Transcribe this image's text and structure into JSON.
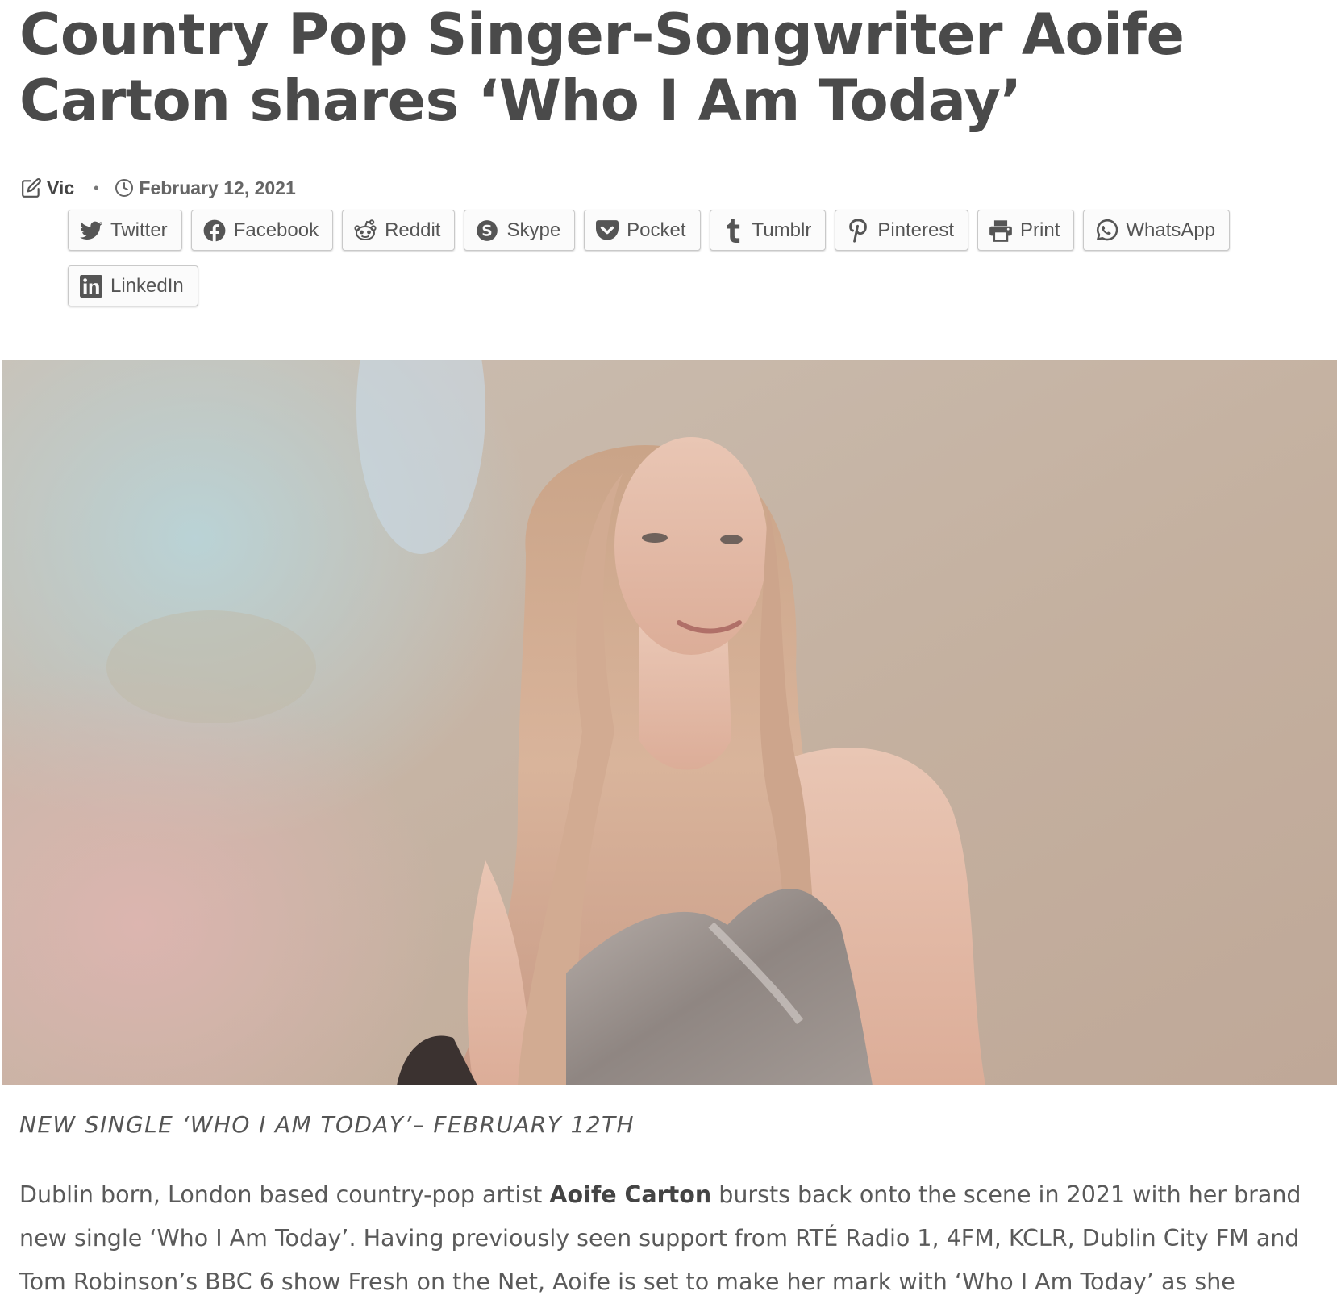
{
  "article": {
    "title": "Country Pop Singer-Songwriter Aoife Carton shares ‘Who I Am Today’",
    "author": "Vic",
    "date": "February 12, 2021",
    "caption": "NEW SINGLE ‘WHO I AM TODAY’– FEBRUARY 12TH",
    "body": {
      "intro": "Dublin born, London based country-pop artist ",
      "artist": "Aoife Carton",
      "rest": " bursts back onto the scene in 2021 with her brand new single ‘Who I Am Today’. Having previously seen support from RTÉ Radio 1, 4FM, KCLR, Dublin City FM and Tom Robinson’s BBC 6 show Fresh on the Net, Aoife is set to make her mark with ‘Who I Am Today’ as she expertly"
    }
  },
  "share": {
    "buttons": [
      {
        "label": "Twitter",
        "icon": "twitter-icon"
      },
      {
        "label": "Facebook",
        "icon": "facebook-icon"
      },
      {
        "label": "Reddit",
        "icon": "reddit-icon"
      },
      {
        "label": "Skype",
        "icon": "skype-icon"
      },
      {
        "label": "Pocket",
        "icon": "pocket-icon"
      },
      {
        "label": "Tumblr",
        "icon": "tumblr-icon"
      },
      {
        "label": "Pinterest",
        "icon": "pinterest-icon"
      },
      {
        "label": "Print",
        "icon": "print-icon"
      },
      {
        "label": "WhatsApp",
        "icon": "whatsapp-icon"
      },
      {
        "label": "LinkedIn",
        "icon": "linkedin-icon"
      }
    ]
  },
  "colors": {
    "title": "#4a4a4a",
    "text": "#5a5a5a",
    "button_border": "#c9c9c9",
    "icon": "#555555"
  }
}
